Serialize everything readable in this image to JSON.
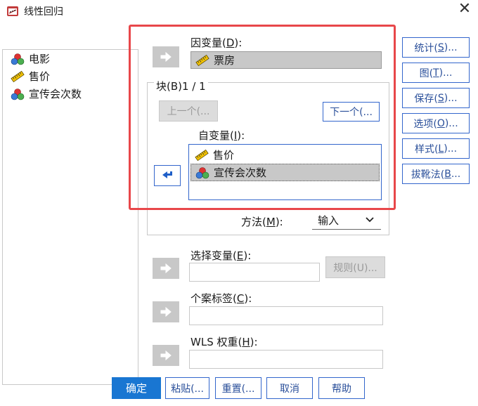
{
  "window": {
    "title": "线性回归"
  },
  "variables": [
    {
      "name": "电影",
      "type": "nominal"
    },
    {
      "name": "售价",
      "type": "scale"
    },
    {
      "name": "宣传会次数",
      "type": "nominal"
    }
  ],
  "dependent": {
    "label": "因变量(D):",
    "label_text": "因变量(",
    "label_key": "D",
    "label_tail": "):",
    "value": "票房"
  },
  "block": {
    "label": "块(B)1 / 1",
    "prev_label": "上一个(...",
    "next_label": "下一个(...",
    "independent_label_text": "自变量(",
    "independent_label_key": "I",
    "independent_label_tail": "):",
    "independents": [
      {
        "name": "售价",
        "type": "scale",
        "selected": false
      },
      {
        "name": "宣传会次数",
        "type": "nominal",
        "selected": true
      }
    ],
    "method_label_text": "方法(",
    "method_label_key": "M",
    "method_label_tail": "):",
    "method_value": "输入"
  },
  "selection": {
    "label_text": "选择变量(",
    "label_key": "E",
    "label_tail": "):",
    "rule_label": "规则(U)..."
  },
  "case_label": {
    "label_text": "个案标签(",
    "label_key": "C",
    "label_tail": "):"
  },
  "wls": {
    "label_text": "WLS 权重(",
    "label_key": "H",
    "label_tail": "):"
  },
  "side_buttons": [
    {
      "text": "统计(",
      "key": "S",
      "tail": ")..."
    },
    {
      "text": "图(",
      "key": "T",
      "tail": ")..."
    },
    {
      "text": "保存(",
      "key": "S",
      "tail": ")..."
    },
    {
      "text": "选项(",
      "key": "O",
      "tail": ")..."
    },
    {
      "text": "样式(",
      "key": "L",
      "tail": ")..."
    },
    {
      "text": "拔靴法(",
      "key": "B",
      "tail": "..."
    }
  ],
  "bottom_buttons": {
    "ok": "确定",
    "paste": "粘贴(...",
    "reset": "重置(...",
    "cancel": "取消",
    "help": "帮助"
  },
  "colors": {
    "accent": "#3366cc",
    "primary": "#1976d2",
    "highlight_frame": "#e8474a"
  }
}
